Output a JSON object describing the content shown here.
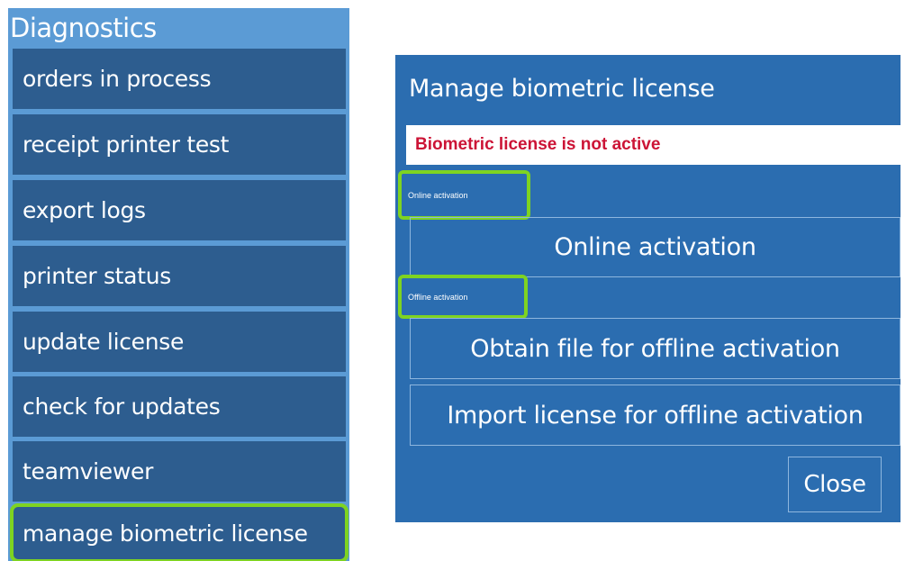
{
  "diagnostics": {
    "title": "Diagnostics",
    "items": [
      {
        "label": "orders in process"
      },
      {
        "label": "receipt printer test"
      },
      {
        "label": "export logs"
      },
      {
        "label": "printer status"
      },
      {
        "label": "update license"
      },
      {
        "label": "check for updates"
      },
      {
        "label": "teamviewer"
      },
      {
        "label": "manage biometric license"
      }
    ]
  },
  "dialog": {
    "title": "Manage biometric license",
    "status_text": "Biometric license is not active",
    "status_color": "#cc1436",
    "online_section_label": "Online activation",
    "online_button": "Online activation",
    "offline_section_label": "Offline activation",
    "obtain_file_button": "Obtain file for offline activation",
    "import_license_button": "Import license for offline activation",
    "close_button": "Close"
  },
  "colors": {
    "menu_background": "#5b9bd5",
    "menu_item": "#2d5d8f",
    "dialog_background": "#2b6db0",
    "highlight": "#7ed321"
  }
}
